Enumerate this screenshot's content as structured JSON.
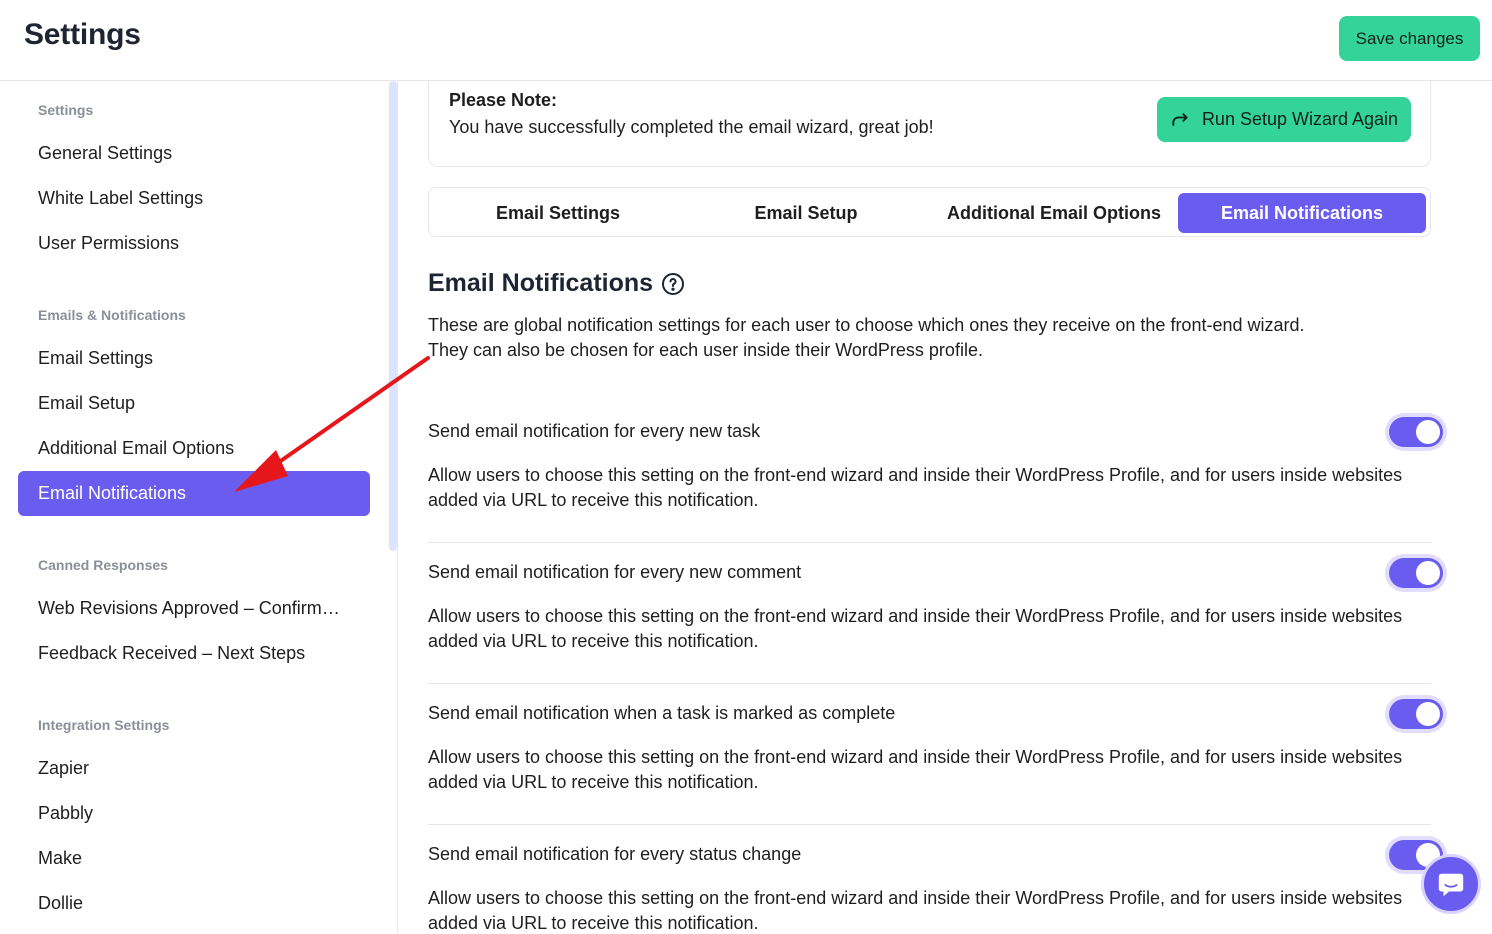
{
  "header": {
    "title": "Settings",
    "save_label": "Save changes"
  },
  "sidebar": {
    "sections": [
      {
        "label": "Settings",
        "items": [
          "General Settings",
          "White Label Settings",
          "User Permissions"
        ]
      },
      {
        "label": "Emails & Notifications",
        "items": [
          "Email Settings",
          "Email Setup",
          "Additional Email Options",
          "Email Notifications"
        ]
      },
      {
        "label": "Canned Responses",
        "items": [
          "Web Revisions Approved – Confirmation",
          "Feedback Received – Next Steps"
        ]
      },
      {
        "label": "Integration Settings",
        "items": [
          "Zapier",
          "Pabbly",
          "Make",
          "Dollie"
        ]
      }
    ],
    "active_item": "Email Notifications"
  },
  "note": {
    "title": "Please Note:",
    "text": "You have successfully completed the email wizard, great job!",
    "button_label": "Run Setup Wizard Again"
  },
  "tabs": [
    {
      "label": "Email Settings",
      "active": false
    },
    {
      "label": "Email Setup",
      "active": false
    },
    {
      "label": "Additional Email Options",
      "active": false
    },
    {
      "label": "Email Notifications",
      "active": true
    }
  ],
  "content": {
    "title": "Email Notifications",
    "description_line1": "These are global notification settings for each user to choose which ones they receive on the front-end wizard.",
    "description_line2": "They can also be chosen for each user inside their WordPress profile."
  },
  "notifications": [
    {
      "title": "Send email notification for every new task",
      "description": "Allow users to choose this setting on the front-end wizard and inside their WordPress Profile, and for users inside websites added via URL to receive this notification.",
      "enabled": true
    },
    {
      "title": "Send email notification for every new comment",
      "description": "Allow users to choose this setting on the front-end wizard and inside their WordPress Profile, and for users inside websites added via URL to receive this notification.",
      "enabled": true
    },
    {
      "title": "Send email notification when a task is marked as complete",
      "description": "Allow users to choose this setting on the front-end wizard and inside their WordPress Profile, and for users inside websites added via URL to receive this notification.",
      "enabled": true
    },
    {
      "title": "Send email notification for every status change",
      "description": "Allow users to choose this setting on the front-end wizard and inside their WordPress Profile, and for users inside websites added via URL to receive this notification.",
      "enabled": true
    }
  ],
  "colors": {
    "accent": "#6b5cf0",
    "success": "#34d399",
    "annotation_arrow": "#e5171b"
  },
  "icons": {
    "wizard_button": "redo-arrow-icon",
    "title_help": "question-circle-icon",
    "chat": "chat-bubble-icon"
  }
}
